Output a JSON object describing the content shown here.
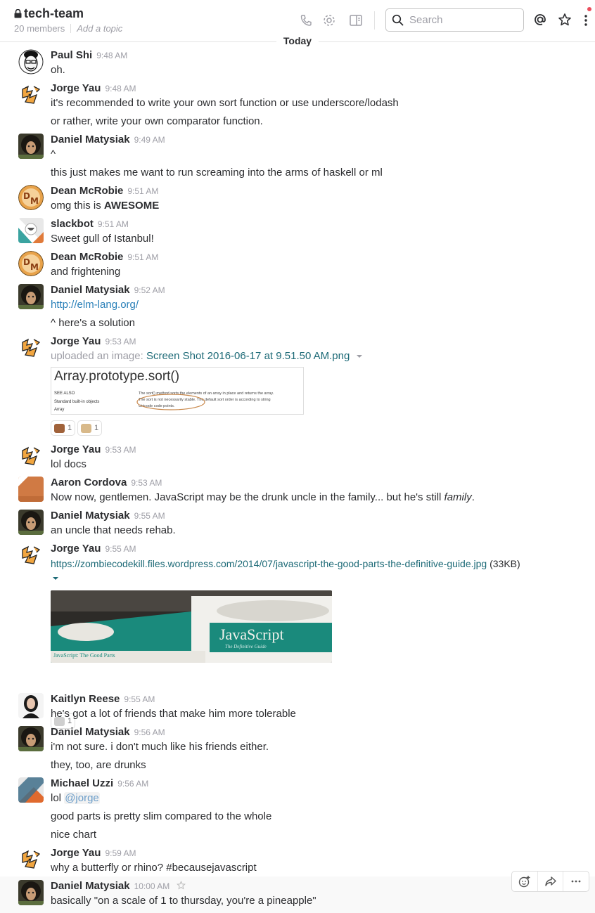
{
  "channel": {
    "name": "tech-team",
    "members": "20 members",
    "topic": "Add a topic"
  },
  "search": {
    "placeholder": "Search"
  },
  "day_divider": "Today",
  "messages": [
    {
      "name": "Paul Shi",
      "time": "9:48 AM",
      "lines": [
        "oh."
      ]
    },
    {
      "name": "Jorge Yau",
      "time": "9:48 AM",
      "lines": [
        "it's recommended to write your own sort function or use underscore/lodash",
        "or rather, write your own comparator function."
      ]
    },
    {
      "name": "Daniel Matysiak",
      "time": "9:49 AM",
      "lines": [
        "^",
        "this just makes me want to run screaming into the arms of haskell or ml"
      ]
    },
    {
      "name": "Dean McRobie",
      "time": "9:51 AM",
      "lines": [
        "omg this is ",
        "AWESOME"
      ]
    },
    {
      "name": "slackbot",
      "time": "9:51 AM",
      "lines": [
        "Sweet gull of Istanbul!"
      ]
    },
    {
      "name": "Dean McRobie",
      "time": "9:51 AM",
      "lines": [
        "and frightening"
      ]
    },
    {
      "name": "Daniel Matysiak",
      "time": "9:52 AM",
      "lines": [
        "http://elm-lang.org/",
        "^ here's a solution"
      ]
    },
    {
      "name": "Jorge Yau",
      "time": "9:53 AM",
      "upload_prefix": "uploaded an image:",
      "upload_file": "Screen Shot 2016-06-17 at 9.51.50 AM.png",
      "preview": {
        "title": "Array.prototype.sort()",
        "see_also": "SEE ALSO",
        "side1": "Standard built-in objects",
        "side2": "Array",
        "body1": "The sort() method sorts the elements of an array in place and returns the array.",
        "body2": "The sort is not necessarily stable. The default sort order is according to string",
        "body3": "Unicode code points."
      },
      "reactions": [
        "1",
        "1"
      ]
    },
    {
      "name": "Jorge Yau",
      "time": "9:53 AM",
      "lines": [
        "lol docs"
      ]
    },
    {
      "name": "Aaron Cordova",
      "time": "9:53 AM",
      "lines": [
        "Now now, gentlemen. JavaScript may be the drunk uncle in the family... but he's still ",
        "family",
        "."
      ]
    },
    {
      "name": "Daniel Matysiak",
      "time": "9:55 AM",
      "lines": [
        "an uncle that needs rehab."
      ]
    },
    {
      "name": "Jorge Yau",
      "time": "9:55 AM",
      "link": "https://zombiecodekill.files.wordpress.com/2014/07/javascript-the-good-parts-the-definitive-guide.jpg",
      "link_size": "(33KB)",
      "book": {
        "title": "JavaScript",
        "subtitle": "The Definitive Guide",
        "spine": "JavaScript: The Good Parts"
      },
      "reactions": [
        "1"
      ]
    },
    {
      "name": "Kaitlyn Reese",
      "time": "9:55 AM",
      "lines": [
        "he's got a lot of friends that make him more tolerable"
      ]
    },
    {
      "name": "Daniel Matysiak",
      "time": "9:56 AM",
      "lines": [
        "i'm not sure. i don't much like his friends either.",
        "they, too, are drunks"
      ]
    },
    {
      "name": "Michael Uzzi",
      "time": "9:56 AM",
      "lines": [
        "lol ",
        "@jorge",
        "good parts is pretty slim compared to the whole",
        "nice chart"
      ]
    },
    {
      "name": "Jorge Yau",
      "time": "9:59 AM",
      "lines": [
        "why a butterfly or rhino? #becausejavascript"
      ]
    },
    {
      "name": "Daniel Matysiak",
      "time": "10:00 AM",
      "lines": [
        "basically \"on a scale of 1 to thursday, you're a pineapple\""
      ]
    }
  ],
  "colors": {
    "text": "#2c2d30",
    "muted": "#9e9ea6",
    "link": "#2a80b9",
    "teal": "#1d6a77",
    "book_teal": "#1a8a7c"
  }
}
